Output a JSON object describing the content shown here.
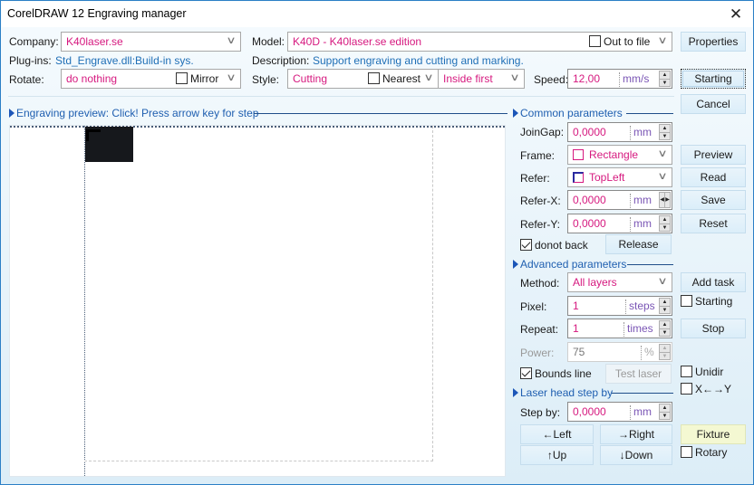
{
  "window": {
    "title": "CorelDRAW 12 Engraving manager",
    "close_icon": "close-icon"
  },
  "top": {
    "company_label": "Company:",
    "company_value": "K40laser.se",
    "model_label": "Model:",
    "model_value": "K40D - K40laser.se edition",
    "out_to_file_label": "Out to file",
    "out_to_file_checked": false,
    "properties_label": "Properties",
    "plugins_label": "Plug-ins:",
    "plugins_value": "Std_Engrave.dll:Build-in sys.",
    "description_label": "Description:",
    "description_value": "Support engraving and cutting and marking.",
    "rotate_label": "Rotate:",
    "rotate_value": "do nothing",
    "mirror_label": "Mirror",
    "mirror_checked": false,
    "style_label": "Style:",
    "style_value": "Cutting",
    "nearest_label": "Nearest",
    "nearest_checked": false,
    "order_value": "Inside first",
    "speed_label": "Speed:",
    "speed_value": "12,00",
    "speed_unit": "mm/s",
    "starting_label": "Starting",
    "cancel_label": "Cancel"
  },
  "preview": {
    "header": "Engraving preview: Click! Press arrow key for step"
  },
  "common": {
    "header": "Common parameters",
    "joingap_label": "JoinGap:",
    "joingap_value": "0,0000",
    "joingap_unit": "mm",
    "frame_label": "Frame:",
    "frame_value": "Rectangle",
    "refer_label": "Refer:",
    "refer_value": "TopLeft",
    "referx_label": "Refer-X:",
    "referx_value": "0,0000",
    "referx_unit": "mm",
    "refery_label": "Refer-Y:",
    "refery_value": "0,0000",
    "refery_unit": "mm",
    "donot_back_label": "donot back",
    "donot_back_checked": true,
    "release_label": "Release",
    "preview_label": "Preview",
    "read_label": "Read",
    "save_label": "Save",
    "reset_label": "Reset"
  },
  "advanced": {
    "header": "Advanced parameters",
    "method_label": "Method:",
    "method_value": "All layers",
    "pixel_label": "Pixel:",
    "pixel_value": "1",
    "pixel_unit": "steps",
    "repeat_label": "Repeat:",
    "repeat_value": "1",
    "repeat_unit": "times",
    "power_label": "Power:",
    "power_value": "75",
    "power_unit": "%",
    "bounds_line_label": "Bounds line",
    "bounds_line_checked": true,
    "test_laser_label": "Test laser",
    "add_task_label": "Add task",
    "starting_chk_label": "Starting",
    "starting_chk_checked": false,
    "stop_label": "Stop",
    "unidir_label": "Unidir",
    "unidir_checked": false,
    "xy_label": "X←→Y",
    "xy_checked": false
  },
  "laserhead": {
    "header": "Laser head step by",
    "stepby_label": "Step by:",
    "stepby_value": "0,0000",
    "stepby_unit": "mm",
    "left_label": "←Left",
    "right_label": "→Right",
    "up_label": "↑Up",
    "down_label": "↓Down",
    "fixture_label": "Fixture",
    "rotary_label": "Rotary",
    "rotary_checked": false
  }
}
